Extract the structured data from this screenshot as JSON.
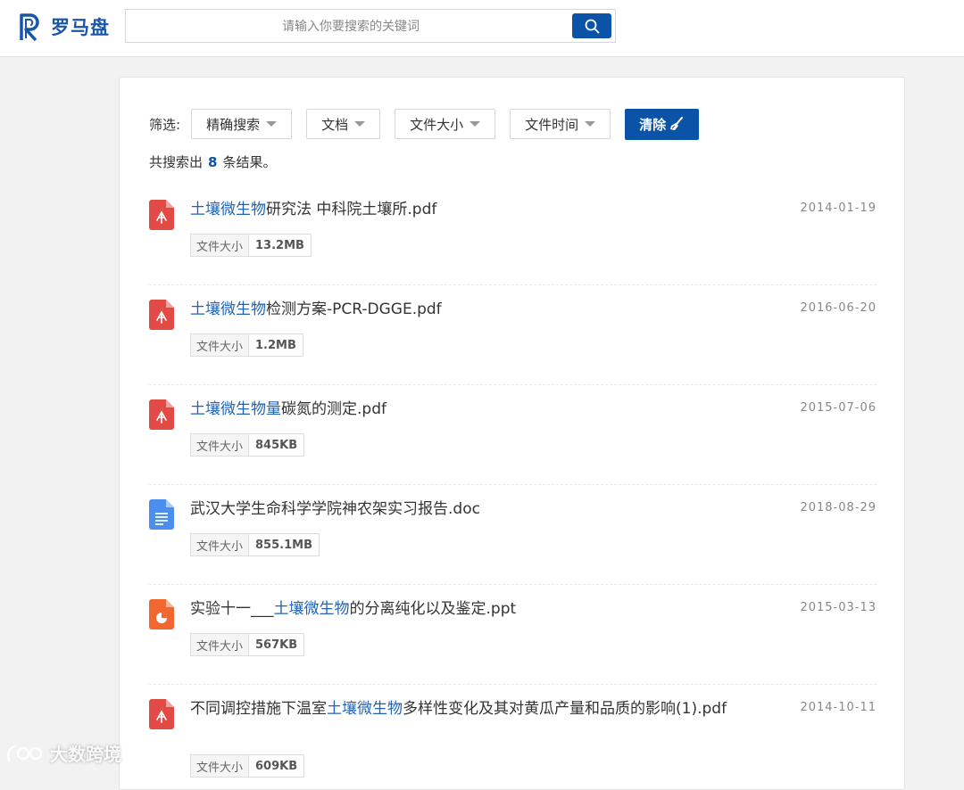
{
  "header": {
    "logo_text": "罗马盘",
    "search_placeholder": "请输入你要搜索的关键词"
  },
  "filters": {
    "label": "筛选:",
    "match_mode": "精确搜索",
    "file_type": "文档",
    "file_size": "文件大小",
    "file_time": "文件时间",
    "clear_label": "清除"
  },
  "summary": {
    "prefix": "共搜索出",
    "count": "8",
    "suffix": "条结果。"
  },
  "results": [
    {
      "pre": "",
      "hl": "土壤微生物",
      "post": "研究法 中科院土壤所.pdf",
      "date": "2014-01-19",
      "size_label": "文件大小",
      "size": "13.2MB",
      "icon": "pdf-icon"
    },
    {
      "pre": "",
      "hl": "土壤微生物",
      "post": "检测方案-PCR-DGGE.pdf",
      "date": "2016-06-20",
      "size_label": "文件大小",
      "size": "1.2MB",
      "icon": "pdf-icon"
    },
    {
      "pre": "",
      "hl": "土壤微生物量",
      "post": "碳氮的测定.pdf",
      "date": "2015-07-06",
      "size_label": "文件大小",
      "size": "845KB",
      "icon": "pdf-icon"
    },
    {
      "pre": "",
      "hl": "",
      "post": "武汉大学生命科学学院神农架实习报告.doc",
      "date": "2018-08-29",
      "size_label": "文件大小",
      "size": "855.1MB",
      "icon": "doc-icon"
    },
    {
      "pre": "实验十一___",
      "hl": "土壤微生物",
      "post": "的分离纯化以及鉴定.ppt",
      "date": "2015-03-13",
      "size_label": "文件大小",
      "size": "567KB",
      "icon": "ppt-icon"
    },
    {
      "pre": "不同调控措施下温室",
      "hl": "土壤微生物",
      "post": "多样性变化及其对黄瓜产量和品质的影响(1).pdf",
      "date": "2014-10-11",
      "size_label": "文件大小",
      "size": "609KB",
      "icon": "pdf-icon"
    }
  ],
  "watermark": "大数跨境",
  "colors": {
    "brand": "#0b53a6",
    "highlight": "#1f63b5",
    "pdf": "#e24a45",
    "doc": "#4a8ef0",
    "ppt": "#f2672f"
  }
}
